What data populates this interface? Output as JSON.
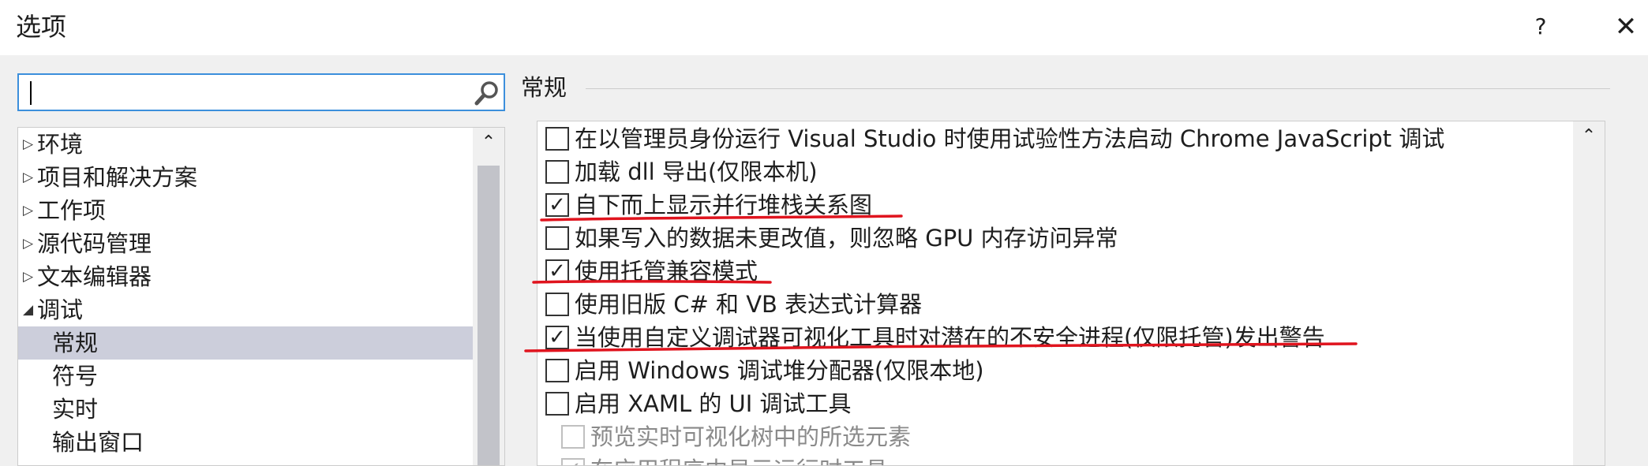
{
  "window": {
    "title": "选项",
    "help_label": "?",
    "close_label": "✕"
  },
  "search": {
    "value": "",
    "placeholder": ""
  },
  "tree": {
    "items": [
      {
        "label": "环境",
        "expander": "▷"
      },
      {
        "label": "项目和解决方案",
        "expander": "▷"
      },
      {
        "label": "工作项",
        "expander": "▷"
      },
      {
        "label": "源代码管理",
        "expander": "▷"
      },
      {
        "label": "文本编辑器",
        "expander": "▷"
      },
      {
        "label": "调试",
        "expander": "◢"
      },
      {
        "label": "常规",
        "expander": ""
      },
      {
        "label": "符号",
        "expander": ""
      },
      {
        "label": "实时",
        "expander": ""
      },
      {
        "label": "输出窗口",
        "expander": ""
      }
    ],
    "selected": "常规",
    "scroll_up": "⌃"
  },
  "section": {
    "title": "常规"
  },
  "options": [
    {
      "label": "在以管理员身份运行 Visual Studio 时使用试验性方法启动 Chrome JavaScript 调试",
      "checked": false,
      "mark": ""
    },
    {
      "label": "加载 dll 导出(仅限本机)",
      "checked": false,
      "mark": ""
    },
    {
      "label": "自下而上显示并行堆栈关系图",
      "checked": true,
      "mark": "✓"
    },
    {
      "label": "如果写入的数据未更改值，则忽略 GPU 内存访问异常",
      "checked": false,
      "mark": ""
    },
    {
      "label": "使用托管兼容模式",
      "checked": true,
      "mark": "✓"
    },
    {
      "label": "使用旧版 C# 和 VB 表达式计算器",
      "checked": false,
      "mark": ""
    },
    {
      "label": "当使用自定义调试器可视化工具时对潜在的不安全进程(仅限托管)发出警告",
      "checked": true,
      "mark": "✓"
    },
    {
      "label": "启用 Windows 调试堆分配器(仅限本地)",
      "checked": false,
      "mark": ""
    },
    {
      "label": "启用 XAML 的 UI 调试工具",
      "checked": false,
      "mark": ""
    },
    {
      "label": "预览实时可视化树中的所选元素",
      "checked": false,
      "mark": "",
      "disabled": true
    },
    {
      "label": "在应用程序中显示运行时工具",
      "checked": true,
      "mark": "✓",
      "disabled": true
    }
  ],
  "colors": {
    "selection": "#cccedb",
    "focus_border": "#3c8fdc",
    "annotation": "#e0141e"
  },
  "icons": {
    "search": "search-icon",
    "close": "close-icon"
  }
}
